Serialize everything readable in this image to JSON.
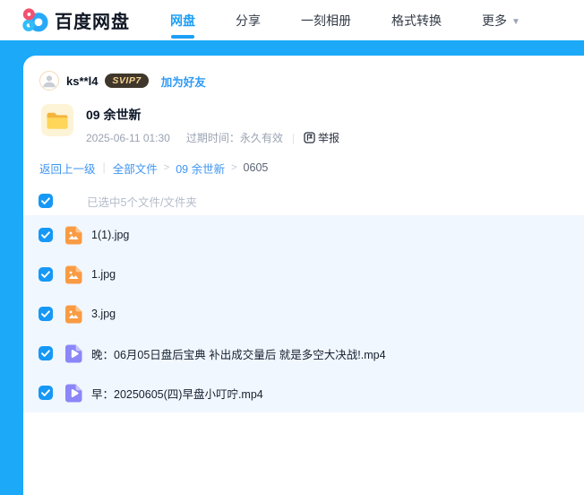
{
  "brand": {
    "logo_text": "百度网盘"
  },
  "nav": {
    "items": [
      {
        "label": "网盘",
        "active": true,
        "dropdown": false
      },
      {
        "label": "分享",
        "active": false,
        "dropdown": false
      },
      {
        "label": "一刻相册",
        "active": false,
        "dropdown": false
      },
      {
        "label": "格式转换",
        "active": false,
        "dropdown": false
      },
      {
        "label": "更多",
        "active": false,
        "dropdown": true
      }
    ]
  },
  "share": {
    "user": {
      "name": "ks**l4",
      "badge": "SVIP7",
      "add_friend": "加为好友"
    },
    "folder": {
      "name": "09 余世新",
      "shared_at": "2025-06-11 01:30",
      "expire": "过期时间：永久有效",
      "report": "举报"
    },
    "breadcrumb": {
      "back": "返回上一级",
      "items": [
        "全部文件",
        "09 余世新",
        "0605"
      ]
    },
    "selection": {
      "summary": "已选中5个文件/文件夹",
      "checked": true
    },
    "files": [
      {
        "name": "1(1).jpg",
        "type": "image",
        "checked": true
      },
      {
        "name": "1.jpg",
        "type": "image",
        "checked": true
      },
      {
        "name": "3.jpg",
        "type": "image",
        "checked": true
      },
      {
        "name": "晚：06月05日盘后宝典 补出成交量后 就是多空大决战!.mp4",
        "type": "video",
        "checked": true
      },
      {
        "name": "早：20250605(四)早盘小叮咛.mp4",
        "type": "video",
        "checked": true
      }
    ]
  },
  "colors": {
    "page_blue": "#1ba9f8",
    "accent": "#1c9ff6",
    "link": "#3d95f2",
    "checkbox": "#1598f6",
    "selected_row_bg": "#f1f7fe",
    "badge_bg": "#3f372b",
    "badge_text": "#f7d290",
    "image_icon": "#f99b44",
    "video_icon": "#8b87f8",
    "folder_yellow": "#fcc84a"
  }
}
